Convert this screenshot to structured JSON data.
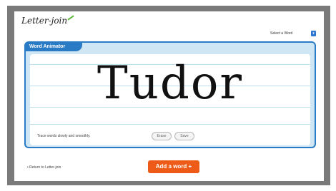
{
  "header": {
    "logo_text": "Letter-join",
    "word_select_label": "Select a Word"
  },
  "animator": {
    "title": "Word Animator",
    "word": "Tudor",
    "hint": "Trace words slowly and smoothly.",
    "erase_label": "Erase",
    "save_label": "Save"
  },
  "footer": {
    "return_link": "• Return to Letter-join",
    "add_word_label": "Add a word +"
  },
  "colors": {
    "accent_blue": "#2a7bc6",
    "add_button_orange": "#ee5b18",
    "logo_leaf_green": "#5cb83a"
  },
  "icons": {
    "select_arrow": "chevron-down-icon",
    "logo_mark": "leaf-icon"
  }
}
